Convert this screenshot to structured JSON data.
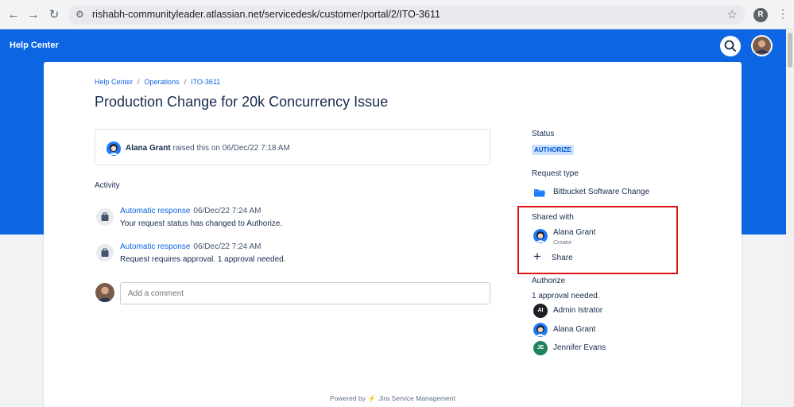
{
  "browser": {
    "url": "rishabh-communityleader.atlassian.net/servicedesk/customer/portal/2/ITO-3611",
    "profile_initial": "R"
  },
  "header": {
    "title": "Help Center"
  },
  "breadcrumb": [
    "Help Center",
    "Operations",
    "ITO-3611"
  ],
  "page_title": "Production Change for 20k Concurrency Issue",
  "raised": {
    "name": "Alana Grant",
    "text": "raised this on 06/Dec/22 7:18 AM"
  },
  "activity": {
    "heading": "Activity",
    "items": [
      {
        "who": "Automatic response",
        "when": "06/Dec/22 7:24 AM",
        "body": "Your request status has changed to Authorize."
      },
      {
        "who": "Automatic response",
        "when": "06/Dec/22 7:24 AM",
        "body": "Request requires approval. 1 approval needed."
      }
    ]
  },
  "comment": {
    "placeholder": "Add a comment"
  },
  "sidebar": {
    "status_label": "Status",
    "status_value": "AUTHORIZE",
    "request_type_label": "Request type",
    "request_type_value": "Bitbucket Software Change",
    "shared_with_label": "Shared with",
    "shared_person": "Alana Grant",
    "shared_role": "Creator",
    "share_label": "Share",
    "authorize_label": "Authorize",
    "approval_note": "1 approval needed.",
    "approvers": [
      {
        "initials": "AI",
        "name": "Admin Istrator"
      },
      {
        "initials": "",
        "name": "Alana Grant"
      },
      {
        "initials": "JE",
        "name": "Jennifer Evans"
      }
    ]
  },
  "footer": {
    "powered_by": "Powered by",
    "product": "Jira Service Management"
  },
  "colors": {
    "brand_blue": "#0c66e4",
    "highlight_red": "#e01414",
    "lozenge_bg": "#cce0ff"
  }
}
